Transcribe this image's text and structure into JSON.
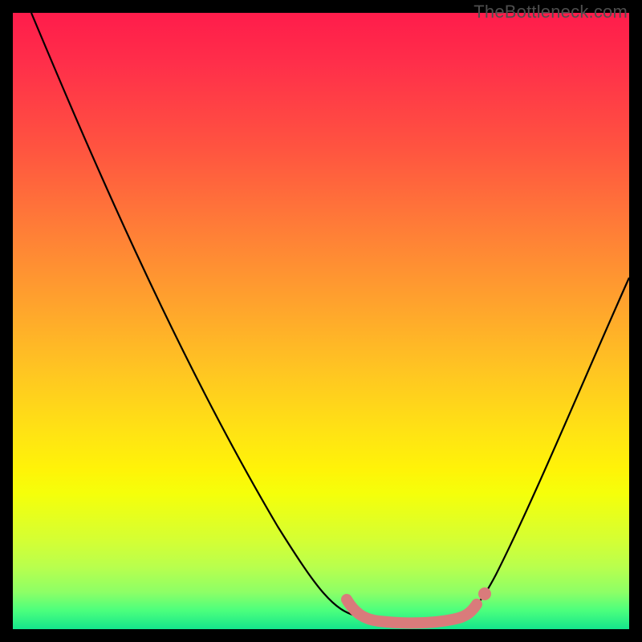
{
  "watermark": "TheBottleneck.com",
  "colors": {
    "frame": "#000000",
    "curve": "#000000",
    "floor_marker": "#d97b7b",
    "gradient_top": "#ff1c4b",
    "gradient_bottom": "#14e58c"
  },
  "chart_data": {
    "type": "line",
    "title": "",
    "xlabel": "",
    "ylabel": "",
    "xlim": [
      0,
      100
    ],
    "ylim": [
      0,
      100
    ],
    "annotations": [
      "TheBottleneck.com"
    ],
    "series": [
      {
        "name": "left-descent",
        "x": [
          3,
          10,
          18,
          26,
          34,
          42,
          50,
          55
        ],
        "values": [
          100,
          84,
          70,
          56,
          42,
          28,
          12,
          3
        ]
      },
      {
        "name": "floor",
        "x": [
          55,
          58,
          62,
          66,
          70,
          74
        ],
        "values": [
          3,
          1,
          0.5,
          0.5,
          0.7,
          2
        ]
      },
      {
        "name": "right-ascent",
        "x": [
          74,
          80,
          86,
          92,
          100
        ],
        "values": [
          2,
          12,
          26,
          40,
          58
        ]
      }
    ],
    "floor_marker": {
      "x": [
        55,
        58,
        62,
        66,
        70,
        74
      ],
      "values": [
        4,
        1.5,
        0.8,
        0.8,
        1.2,
        3
      ],
      "end_dot": {
        "x": 74.5,
        "value": 4
      }
    }
  }
}
